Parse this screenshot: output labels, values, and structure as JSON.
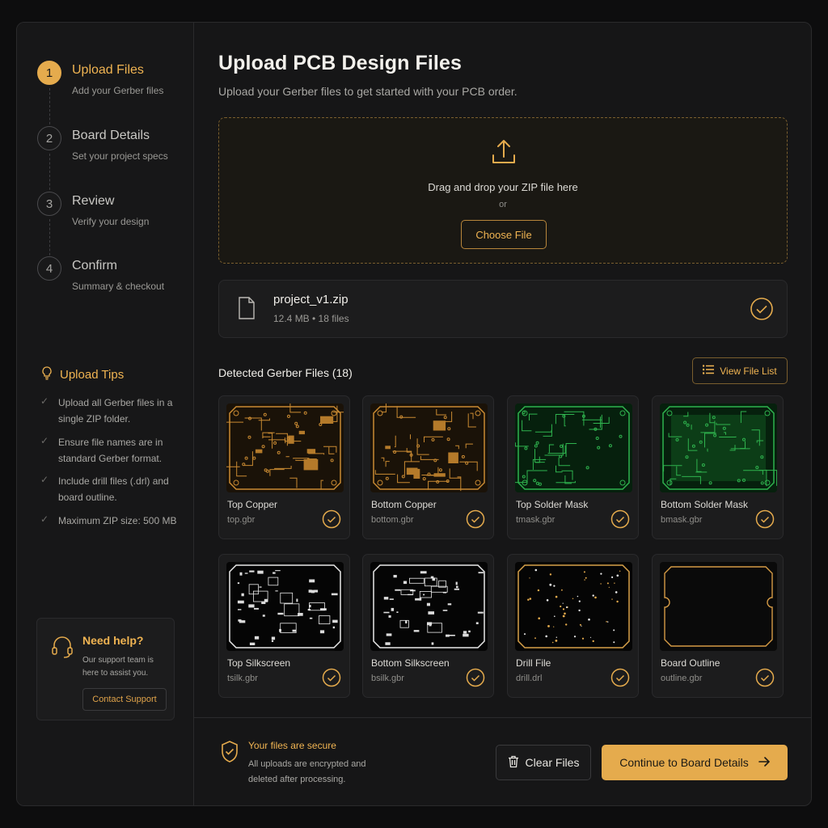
{
  "steps": [
    {
      "number": "1",
      "title": "Upload Files",
      "subtitle": "Add your Gerber files"
    },
    {
      "number": "2",
      "title": "Board Details",
      "subtitle": "Set your project specs"
    },
    {
      "number": "3",
      "title": "Review",
      "subtitle": "Verify your design"
    },
    {
      "number": "4",
      "title": "Confirm",
      "subtitle": "Summary & checkout"
    }
  ],
  "tips": {
    "title": "Upload Tips",
    "items": [
      "Upload all Gerber files in a single ZIP folder.",
      "Ensure file names are in standard Gerber format.",
      "Include drill files (.drl) and board outline.",
      "Maximum ZIP size: 500 MB"
    ]
  },
  "help": {
    "title": "Need help?",
    "text": "Our support team is here to assist you.",
    "button": "Contact Support"
  },
  "main": {
    "title": "Upload PCB Design Files",
    "subtitle": "Upload your Gerber files to get started with your PCB order."
  },
  "dropzone": {
    "text": "Drag and drop your ZIP file here",
    "or": "or",
    "button": "Choose File"
  },
  "uploaded_file": {
    "name": "project_v1.zip",
    "meta": "12.4 MB • 18 files"
  },
  "detected": {
    "title": "Detected Gerber Files (18)",
    "view_button": "View File List",
    "files": [
      {
        "name": "Top Copper",
        "file": "top.gbr",
        "style": "copper"
      },
      {
        "name": "Bottom Copper",
        "file": "bottom.gbr",
        "style": "copper"
      },
      {
        "name": "Top Solder Mask",
        "file": "tmask.gbr",
        "style": "mask"
      },
      {
        "name": "Bottom Solder Mask",
        "file": "bmask.gbr",
        "style": "mask"
      },
      {
        "name": "Top Silkscreen",
        "file": "tsilk.gbr",
        "style": "silk"
      },
      {
        "name": "Bottom Silkscreen",
        "file": "bsilk.gbr",
        "style": "silk"
      },
      {
        "name": "Drill File",
        "file": "drill.drl",
        "style": "drill"
      },
      {
        "name": "Board Outline",
        "file": "outline.gbr",
        "style": "outline"
      }
    ]
  },
  "footer": {
    "secure_title": "Your files are secure",
    "secure_text": "All uploads are encrypted and deleted after processing.",
    "clear_button": "Clear Files",
    "continue_button": "Continue to Board Details"
  },
  "colors": {
    "accent": "#e5ab4d",
    "background": "#161617",
    "card": "#1c1c1d",
    "mask_green": "#1f8a3a"
  }
}
